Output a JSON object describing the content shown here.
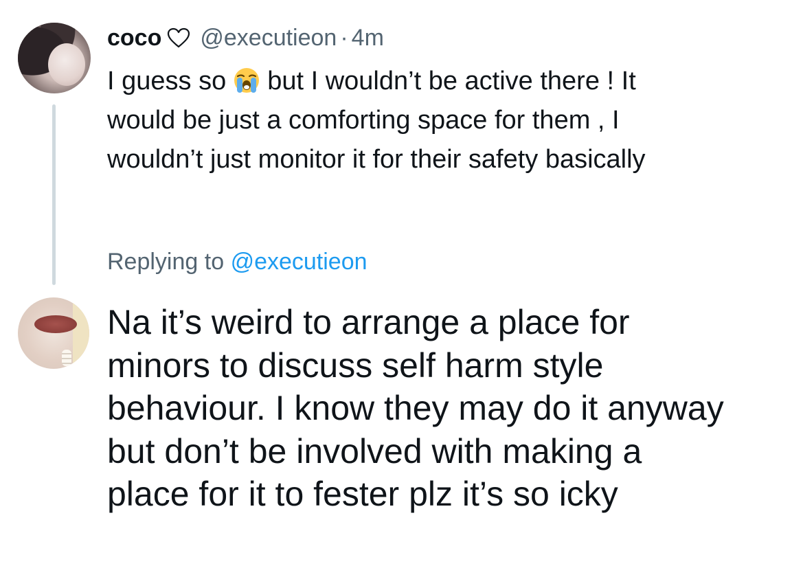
{
  "parent_tweet": {
    "display_name": "coco",
    "handle": "@executieon",
    "separator": "·",
    "time": "4m",
    "heart_icon": "heart-outline-icon",
    "text_lines": [
      {
        "before_emoji": "I guess so",
        "emoji": "😭",
        "after_emoji": "but I wouldn’t be active there ! It"
      },
      "would be just a comforting space for them , I",
      "wouldn’t just monitor it for their safety basically"
    ]
  },
  "reply_tweet": {
    "replying_prefix": "Replying to",
    "replying_mention": "@executieon",
    "text_lines": [
      "Na it’s weird to arrange a place for",
      "minors to discuss self harm style",
      "behaviour. I know they may do it anyway",
      "but don’t be involved with making a",
      "place for it to fester plz it’s so icky"
    ]
  },
  "colors": {
    "text_primary": "#0f1419",
    "text_secondary": "#536471",
    "mention": "#1d9bf0",
    "thread_line": "#cfd9de"
  }
}
